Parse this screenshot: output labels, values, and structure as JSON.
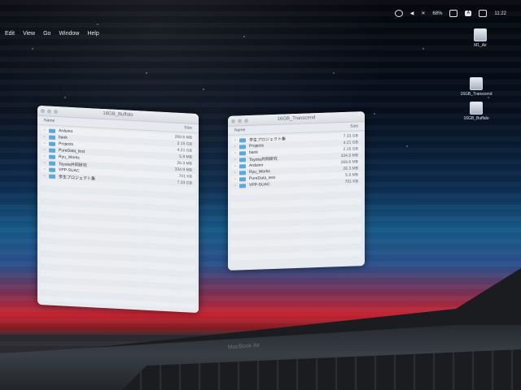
{
  "menubar": {
    "items": [
      "Edit",
      "View",
      "Go",
      "Window",
      "Help"
    ]
  },
  "status_bar": {
    "battery": "68%",
    "time": "11:22",
    "input_letter": "A"
  },
  "desktop_icons": [
    {
      "label": "M1_Air"
    },
    {
      "label": "16GB_Transcend"
    },
    {
      "label": "16GB_Buffalo"
    }
  ],
  "left_window": {
    "title": "16GB_Buffalo",
    "header_name": "Name",
    "header_size": "Size",
    "rows": [
      {
        "name": "Arduino",
        "size": "269.6 MB"
      },
      {
        "name": "bank",
        "size": "2.15 GB"
      },
      {
        "name": "Projects",
        "size": "4.21 GB"
      },
      {
        "name": "PureData_test",
        "size": "5.9 MB"
      },
      {
        "name": "Ryu_Works",
        "size": "26.3 MB"
      },
      {
        "name": "Toyota共同研究",
        "size": "334.9 MB"
      },
      {
        "name": "VPP-SUAC",
        "size": "701 KB"
      },
      {
        "name": "学生プロジェクト集",
        "size": "7.33 GB"
      }
    ]
  },
  "right_window": {
    "title": "16GB_Transcend",
    "header_name": "Name",
    "header_size": "Size",
    "rows": [
      {
        "name": "学生プロジェクト集",
        "size": "7.33 GB"
      },
      {
        "name": "Projects",
        "size": "4.21 GB"
      },
      {
        "name": "bank",
        "size": "2.15 GB"
      },
      {
        "name": "Toyota共同研究",
        "size": "334.9 MB"
      },
      {
        "name": "Arduino",
        "size": "269.6 MB"
      },
      {
        "name": "Ryu_Works",
        "size": "26.3 MB"
      },
      {
        "name": "PureData_test",
        "size": "5.9 MB"
      },
      {
        "name": "VPP-SUAC",
        "size": "701 KB"
      }
    ]
  },
  "hardware": {
    "brand": "MacBook Air"
  }
}
